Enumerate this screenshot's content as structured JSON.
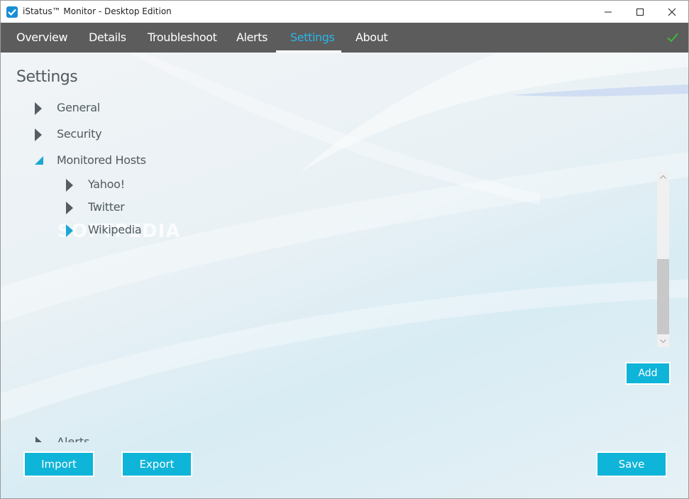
{
  "window": {
    "title": "iStatus™ Monitor - Desktop Edition"
  },
  "nav": {
    "tabs": [
      {
        "label": "Overview"
      },
      {
        "label": "Details"
      },
      {
        "label": "Troubleshoot"
      },
      {
        "label": "Alerts"
      },
      {
        "label": "Settings",
        "active": true
      },
      {
        "label": "About"
      }
    ],
    "status_icon": "check-icon"
  },
  "settings": {
    "heading": "Settings",
    "sections": [
      {
        "label": "General",
        "expanded": false
      },
      {
        "label": "Security",
        "expanded": false
      },
      {
        "label": "Monitored Hosts",
        "expanded": true,
        "hosts": [
          {
            "label": "Yahoo!",
            "expanded": false
          },
          {
            "label": "Twitter",
            "expanded": false
          },
          {
            "label": "Wikipedia",
            "expanded": false,
            "highlighted": true
          }
        ]
      },
      {
        "label": "Alerts",
        "expanded": false
      }
    ],
    "scrollbar_position": 0.62
  },
  "watermark": "SOFTPEDIA",
  "buttons": {
    "add": "Add",
    "import": "Import",
    "export": "Export",
    "save": "Save"
  },
  "colors": {
    "accent": "#0fb4d9",
    "nav_bg": "#5c5c5c",
    "active_tab": "#29b6e8",
    "status_ok": "#3dbb3d"
  }
}
